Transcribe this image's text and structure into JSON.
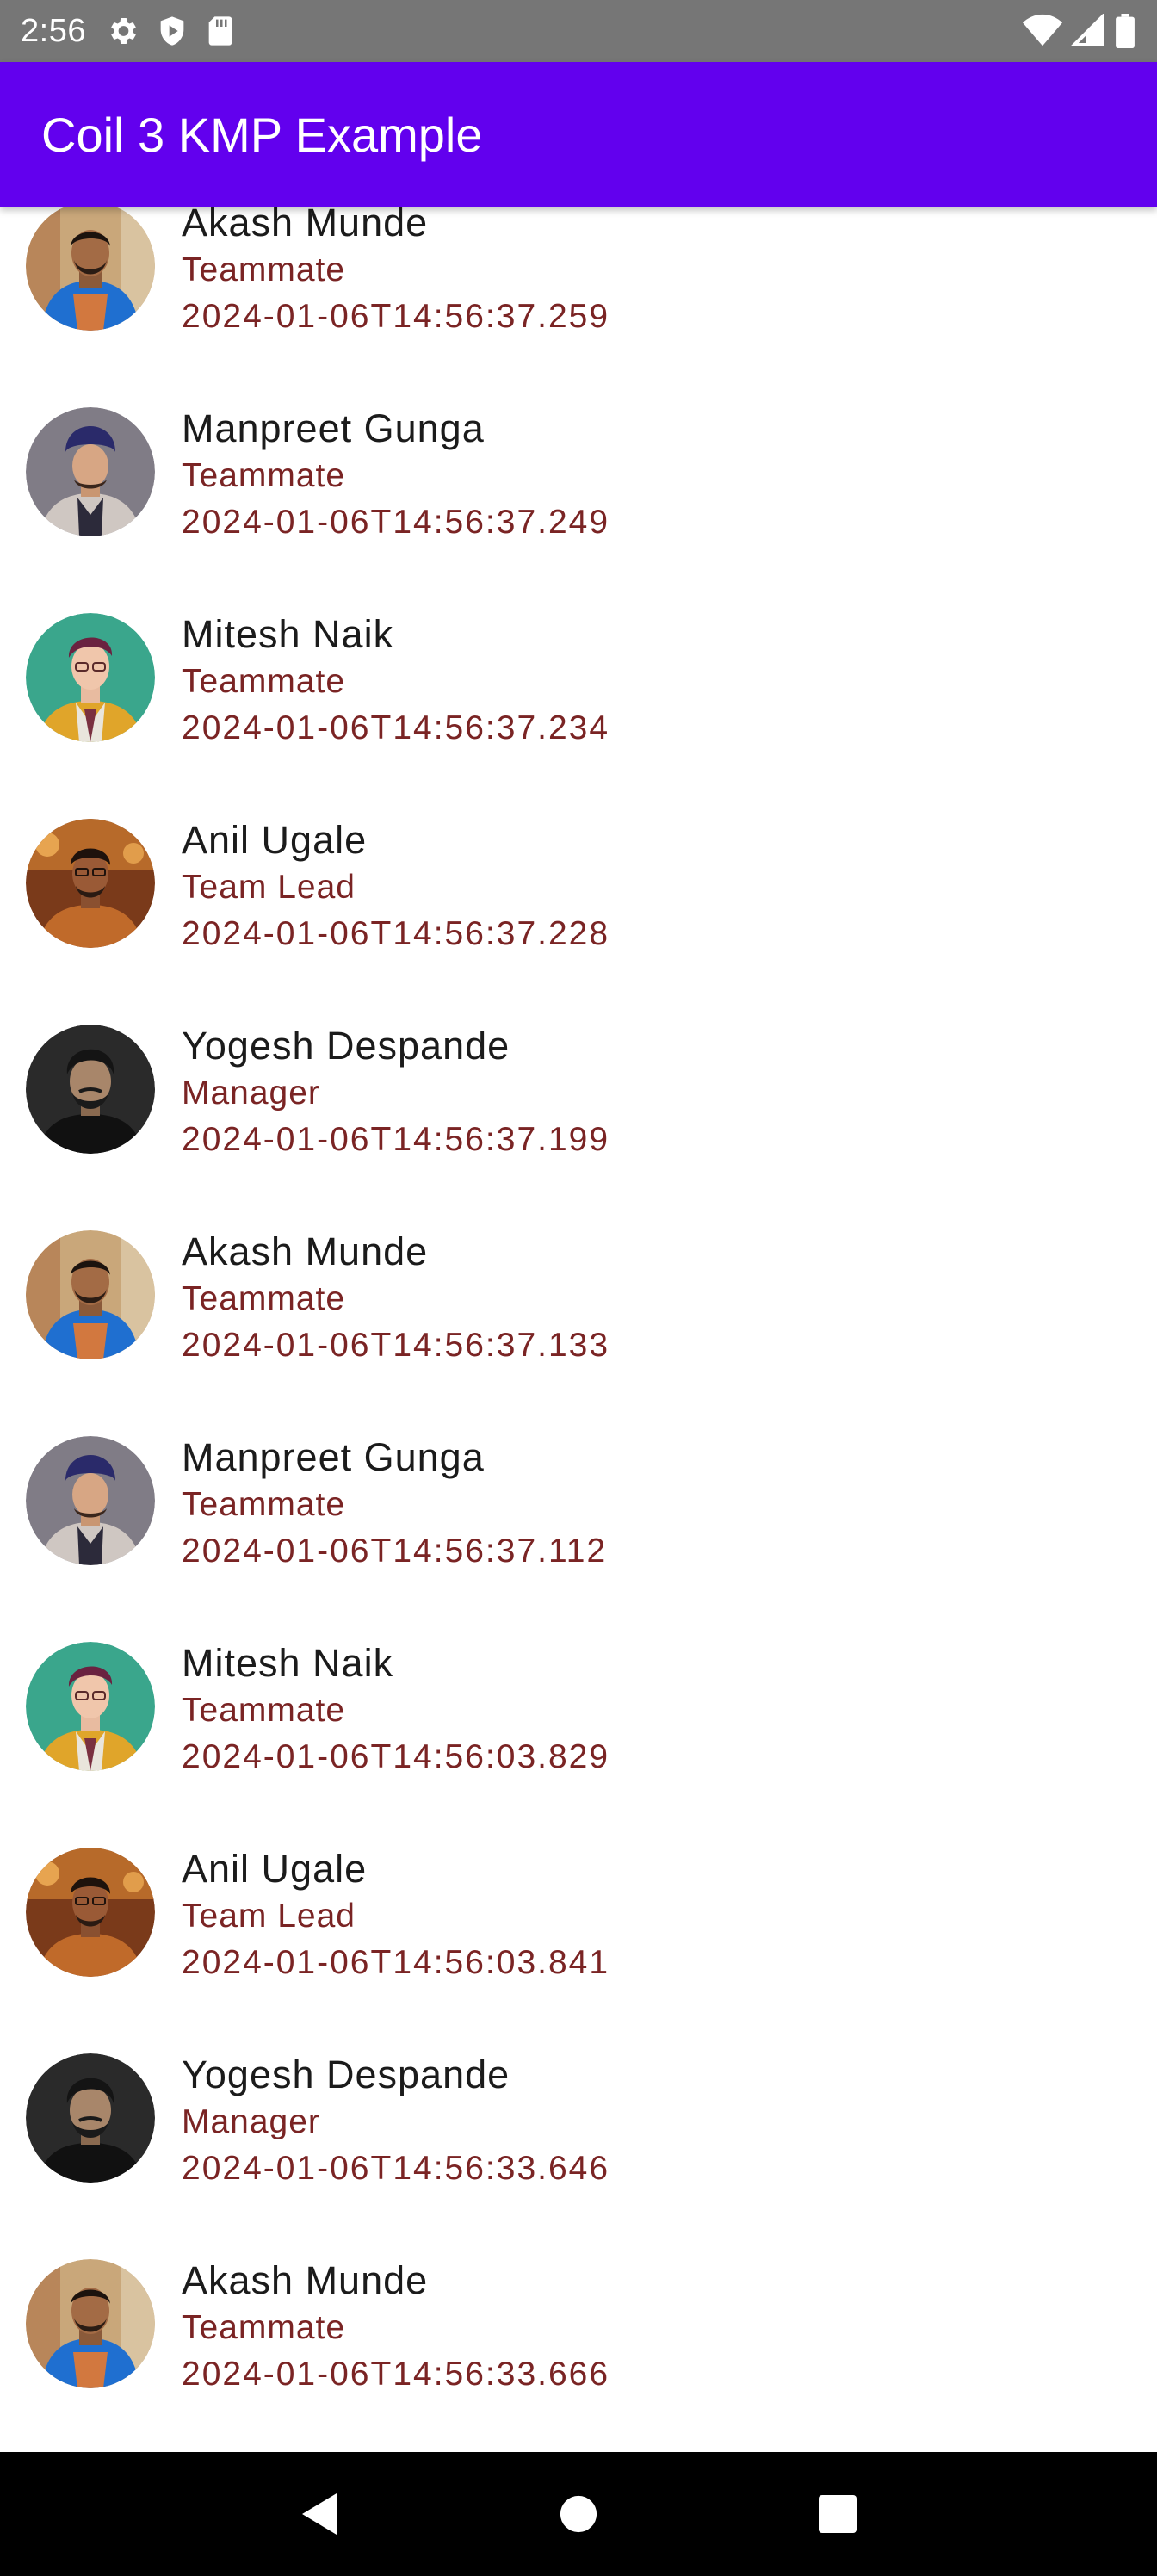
{
  "status_bar": {
    "time": "2:56",
    "left_icons": [
      "gear-icon",
      "shield-play-icon",
      "sd-card-icon"
    ],
    "right_icons": [
      "wifi-icon",
      "cell-signal-icon",
      "battery-icon"
    ]
  },
  "app_bar": {
    "title": "Coil 3 KMP Example",
    "color": "#6200ee"
  },
  "list": {
    "items": [
      {
        "name": "Akash Munde",
        "role": "Teammate",
        "timestamp": "2024-01-06T14:56:37.259",
        "avatar": "akash"
      },
      {
        "name": "Manpreet Gunga",
        "role": "Teammate",
        "timestamp": "2024-01-06T14:56:37.249",
        "avatar": "manpreet"
      },
      {
        "name": "Mitesh Naik",
        "role": "Teammate",
        "timestamp": "2024-01-06T14:56:37.234",
        "avatar": "mitesh"
      },
      {
        "name": "Anil Ugale",
        "role": "Team Lead",
        "timestamp": "2024-01-06T14:56:37.228",
        "avatar": "anil"
      },
      {
        "name": "Yogesh Despande",
        "role": "Manager",
        "timestamp": "2024-01-06T14:56:37.199",
        "avatar": "yogesh"
      },
      {
        "name": "Akash Munde",
        "role": "Teammate",
        "timestamp": "2024-01-06T14:56:37.133",
        "avatar": "akash"
      },
      {
        "name": "Manpreet Gunga",
        "role": "Teammate",
        "timestamp": "2024-01-06T14:56:37.112",
        "avatar": "manpreet"
      },
      {
        "name": "Mitesh Naik",
        "role": "Teammate",
        "timestamp": "2024-01-06T14:56:03.829",
        "avatar": "mitesh"
      },
      {
        "name": "Anil Ugale",
        "role": "Team Lead",
        "timestamp": "2024-01-06T14:56:03.841",
        "avatar": "anil"
      },
      {
        "name": "Yogesh Despande",
        "role": "Manager",
        "timestamp": "2024-01-06T14:56:33.646",
        "avatar": "yogesh"
      },
      {
        "name": "Akash Munde",
        "role": "Teammate",
        "timestamp": "2024-01-06T14:56:33.666",
        "avatar": "akash"
      }
    ]
  },
  "nav_bar": {
    "buttons": [
      "back-icon",
      "home-icon",
      "recents-icon"
    ]
  }
}
